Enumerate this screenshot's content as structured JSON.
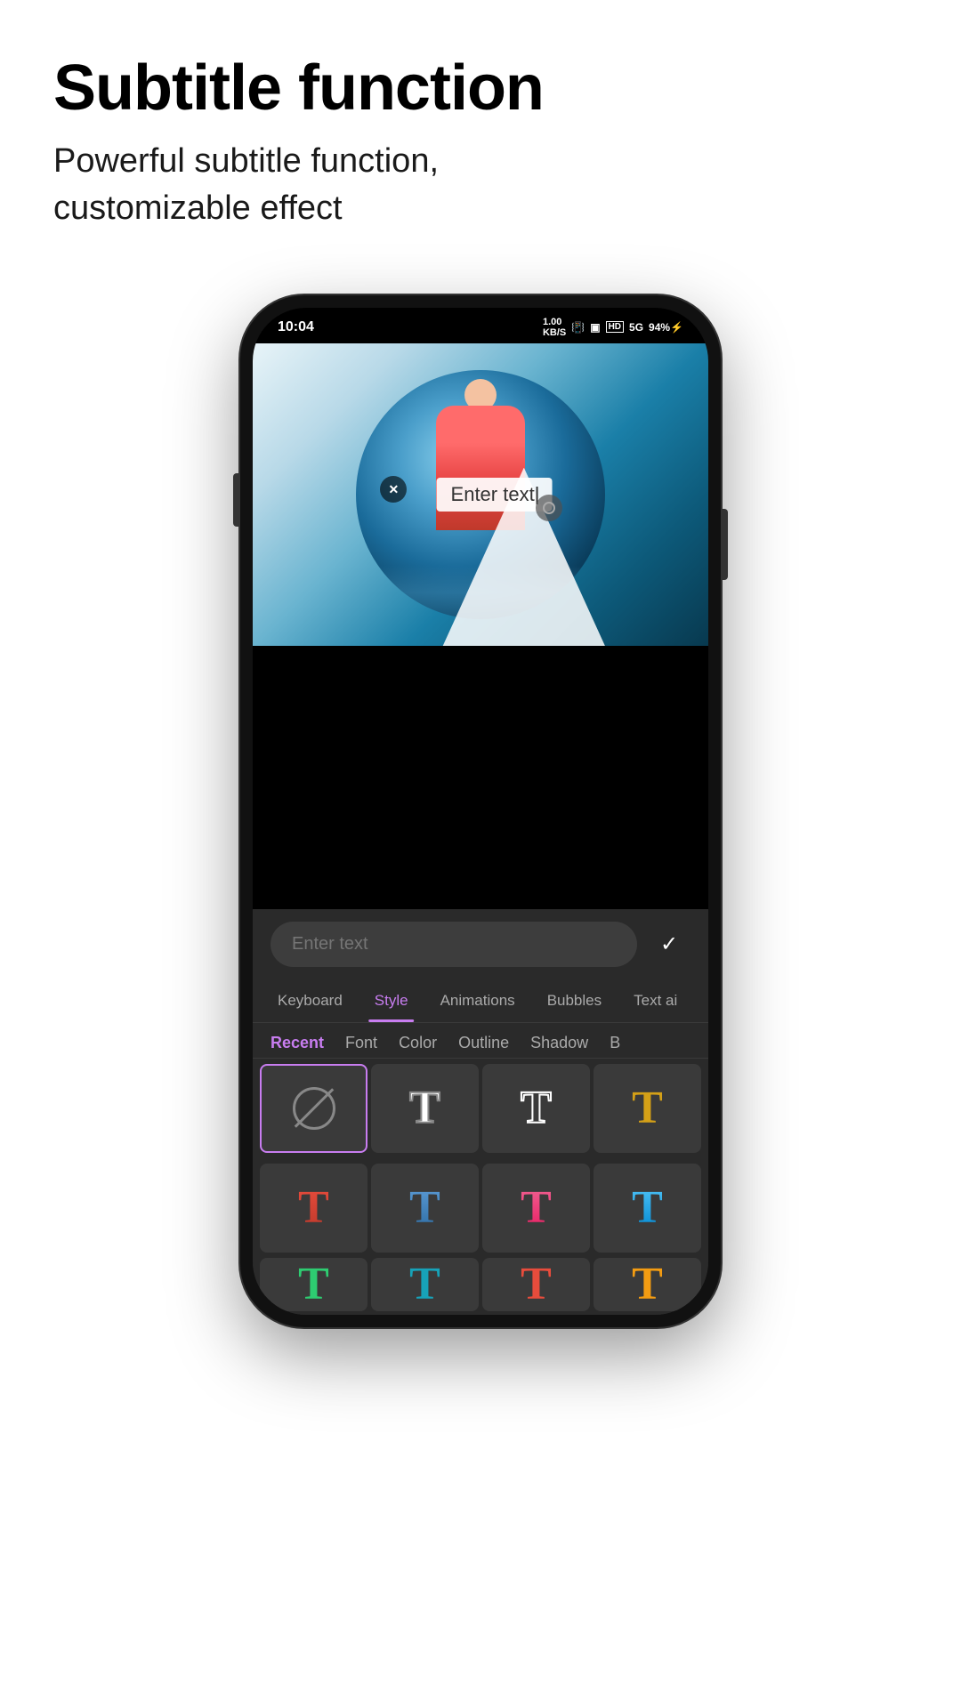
{
  "header": {
    "title": "Subtitle function",
    "subtitle_line1": "Powerful subtitle function,",
    "subtitle_line2": "customizable effect"
  },
  "phone": {
    "status_bar": {
      "time": "10:04",
      "icons_text": "1.00 KB/S  HD  5G  94%"
    },
    "video": {
      "text_overlay": "Enter text"
    },
    "bottom_panel": {
      "input_placeholder": "Enter text",
      "check_icon": "✓",
      "tabs": [
        {
          "label": "Keyboard",
          "active": false
        },
        {
          "label": "Style",
          "active": true
        },
        {
          "label": "Animations",
          "active": false
        },
        {
          "label": "Bubbles",
          "active": false
        },
        {
          "label": "Text ai",
          "active": false
        }
      ],
      "sub_tabs": [
        {
          "label": "Recent",
          "active": true
        },
        {
          "label": "Font",
          "active": false
        },
        {
          "label": "Color",
          "active": false
        },
        {
          "label": "Outline",
          "active": false
        },
        {
          "label": "Shadow",
          "active": false
        },
        {
          "label": "B",
          "active": false
        }
      ],
      "style_grid_row1": [
        {
          "type": "prohibit",
          "selected": true
        },
        {
          "type": "t-white-stroke",
          "selected": false
        },
        {
          "type": "t-outline",
          "selected": false
        },
        {
          "type": "t-yellow",
          "selected": false
        }
      ],
      "style_grid_row2": [
        {
          "type": "t-red",
          "color": "red"
        },
        {
          "type": "t-blue",
          "color": "blue"
        },
        {
          "type": "t-pink",
          "color": "pink"
        },
        {
          "type": "t-blue2",
          "color": "blue2"
        }
      ],
      "style_grid_row3_partial": [
        {
          "type": "t-green",
          "color": "#2ecc71"
        },
        {
          "type": "t-cyan",
          "color": "#17a2b8"
        },
        {
          "type": "t-red2",
          "color": "#e74c3c"
        },
        {
          "type": "t-gold",
          "color": "#f39c12"
        }
      ]
    }
  },
  "colors": {
    "accent": "#c87df0",
    "background": "#ffffff",
    "phone_body": "#111111",
    "panel_bg": "#2a2a2a",
    "cell_bg": "#3a3a3a"
  }
}
